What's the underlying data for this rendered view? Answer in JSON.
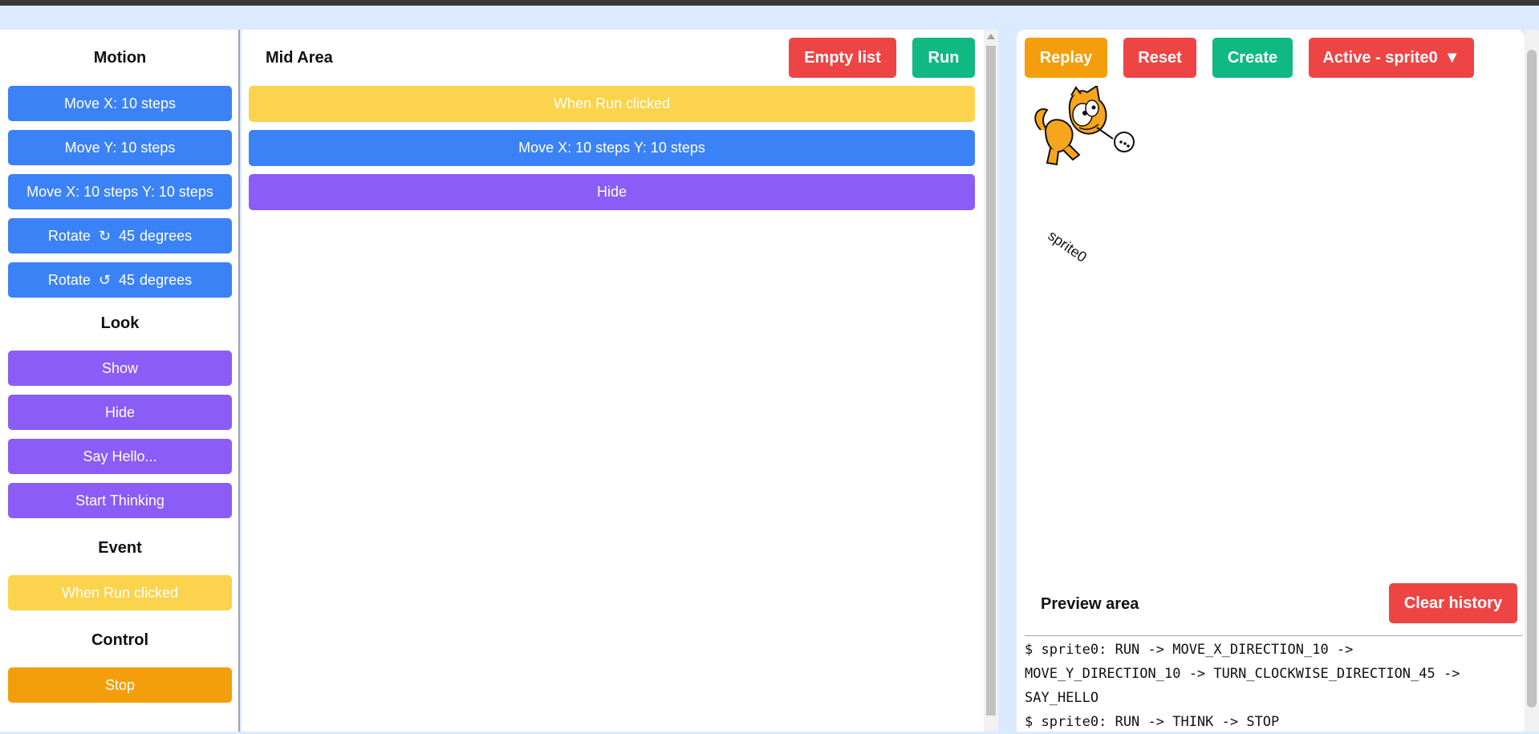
{
  "sidebar": {
    "motion_title": "Motion",
    "look_title": "Look",
    "event_title": "Event",
    "control_title": "Control",
    "motion": [
      {
        "label": "Move X: 10 steps"
      },
      {
        "label": "Move Y: 10 steps"
      },
      {
        "label": "Move X: 10 steps Y: 10 steps"
      },
      {
        "label_a": "Rotate",
        "label_b": "45",
        "label_c": "degrees",
        "icon": "rotate-clockwise-icon"
      },
      {
        "label_a": "Rotate",
        "label_b": "45",
        "label_c": "degrees",
        "icon": "rotate-counterclockwise-icon"
      }
    ],
    "look": [
      {
        "label": "Show"
      },
      {
        "label": "Hide"
      },
      {
        "label": "Say Hello..."
      },
      {
        "label": "Start Thinking"
      }
    ],
    "event": [
      {
        "label": "When Run clicked"
      }
    ],
    "control": [
      {
        "label": "Stop"
      }
    ]
  },
  "mid": {
    "title": "Mid Area",
    "empty_label": "Empty list",
    "run_label": "Run",
    "blocks": [
      {
        "label": "When Run clicked"
      },
      {
        "label": "Move X: 10 steps Y: 10 steps"
      },
      {
        "label": "Hide"
      }
    ]
  },
  "right": {
    "replay_label": "Replay",
    "reset_label": "Reset",
    "create_label": "Create",
    "active_label": "Active - sprite0",
    "active_arrow": "▼",
    "sprite_name": "sprite0",
    "preview_title": "Preview area",
    "clear_label": "Clear history",
    "log": [
      "$ sprite0: RUN -> MOVE_X_DIRECTION_10 ->",
      "MOVE_Y_DIRECTION_10 -> TURN_CLOCKWISE_DIRECTION_45 ->",
      "SAY_HELLO",
      "$ sprite0: RUN -> THINK -> STOP"
    ]
  },
  "colors": {
    "motion": "#3b82f6",
    "look": "#8b5cf6",
    "event": "#fcd34d",
    "control": "#f59e0b",
    "danger": "#ef4444",
    "success": "#10b981"
  }
}
